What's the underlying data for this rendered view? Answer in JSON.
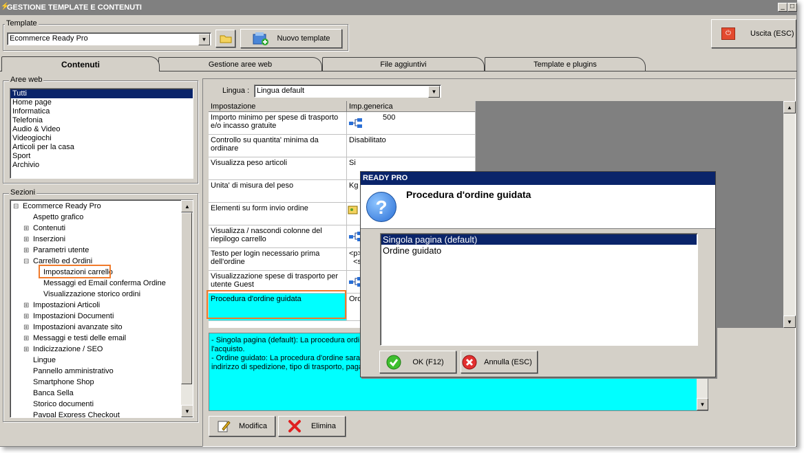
{
  "window": {
    "title": "GESTIONE TEMPLATE E CONTENUTI"
  },
  "template_group": {
    "label": "Template",
    "selected": "Ecommerce Ready Pro",
    "new_button": "Nuovo template"
  },
  "exit_button": "Uscita (ESC)",
  "tabs": [
    "Contenuti",
    "Gestione aree web",
    "File aggiuntivi",
    "Template e plugins"
  ],
  "aree_web": {
    "label": "Aree web",
    "items": [
      "Tutti",
      "Home page",
      "Informatica",
      "Telefonia",
      "Audio & Video",
      "Videogiochi",
      "Articoli per la casa",
      "Sport",
      "Archivio"
    ]
  },
  "sezioni": {
    "label": "Sezioni",
    "items": [
      {
        "text": "Ecommerce Ready Pro",
        "expander": "⊟"
      },
      {
        "text": "Aspetto grafico",
        "expander": ""
      },
      {
        "text": "Contenuti",
        "expander": "⊞"
      },
      {
        "text": "Inserzioni",
        "expander": "⊞"
      },
      {
        "text": "Parametri utente",
        "expander": "⊞"
      },
      {
        "text": "Carrello ed Ordini",
        "expander": "⊟"
      },
      {
        "text": "Impostazioni carrello",
        "expander": ""
      },
      {
        "text": "Messaggi ed Email conferma Ordine",
        "expander": ""
      },
      {
        "text": "Visualizzazione storico ordini",
        "expander": ""
      },
      {
        "text": "Impostazioni Articoli",
        "expander": "⊞"
      },
      {
        "text": "Impostazioni Documenti",
        "expander": "⊞"
      },
      {
        "text": "Impostazioni avanzate sito",
        "expander": "⊞"
      },
      {
        "text": "Messaggi e testi delle email",
        "expander": "⊞"
      },
      {
        "text": "Indicizzazione / SEO",
        "expander": "⊞"
      },
      {
        "text": "Lingue",
        "expander": ""
      },
      {
        "text": "Pannello amministrativo",
        "expander": ""
      },
      {
        "text": "Smartphone Shop",
        "expander": ""
      },
      {
        "text": "Banca Sella",
        "expander": ""
      },
      {
        "text": "Storico documenti",
        "expander": ""
      },
      {
        "text": "Paypal Express Checkout",
        "expander": ""
      }
    ]
  },
  "lingua": {
    "label": "Lingua :",
    "selected": "Lingua default"
  },
  "grid": {
    "headers": [
      "Impostazione",
      "Imp.generica"
    ],
    "rows": [
      {
        "setting": "Importo minimo per spese di trasporto e/o incasso gratuite",
        "value": "500"
      },
      {
        "setting": "Controllo su quantita' minima da ordinare",
        "value": "Disabilitato"
      },
      {
        "setting": "Visualizza peso articoli",
        "value": "Si"
      },
      {
        "setting": "Unita' di misura del peso",
        "value": "Kg"
      },
      {
        "setting": "Elementi su form invio ordine",
        "value": ""
      },
      {
        "setting": "Visualizza / nascondi colonne del riepilogo carrello",
        "value": ""
      },
      {
        "setting": "Testo per login necessario prima dell'ordine",
        "value": "<p>\n  <s"
      },
      {
        "setting": "Visualizzazione spese di trasporto per utente Guest",
        "value": ""
      },
      {
        "setting": "Procedura d'ordine guidata",
        "value": "Ord"
      }
    ]
  },
  "description": {
    "lines": [
      "- Singola pagina (default):  La procedura ordi",
      "l'acquisto.",
      "- Ordine guidato: La procedura d'ordine sara'",
      "indirizzo di spedizione, tipo di trasporto, paga"
    ]
  },
  "bottom_buttons": {
    "modify": "Modifica",
    "delete": "Elimina"
  },
  "dialog": {
    "title": "READY PRO",
    "heading": "Procedura d'ordine guidata",
    "options": [
      "Singola pagina (default)",
      "Ordine guidato"
    ],
    "ok": "OK (F12)",
    "cancel": "Annulla (ESC)"
  }
}
